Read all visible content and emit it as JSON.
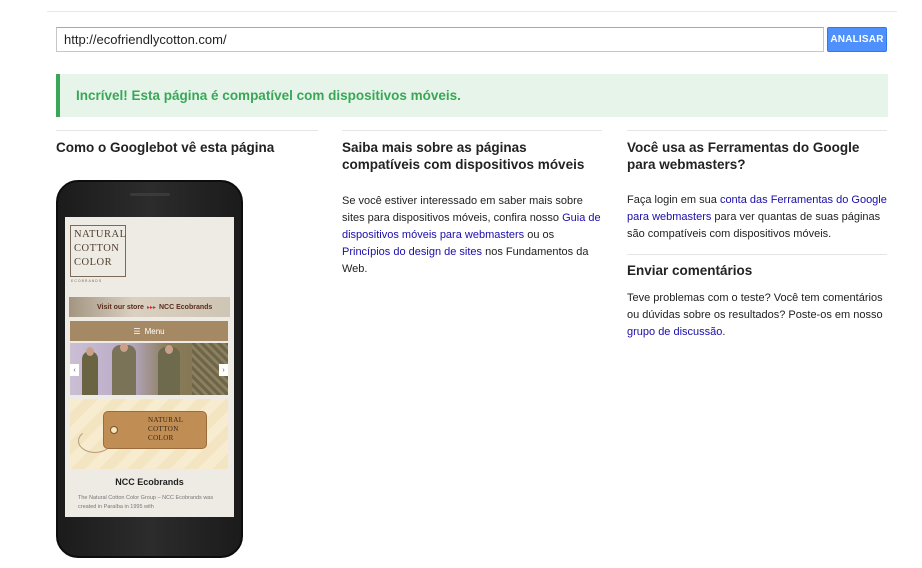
{
  "url_bar": {
    "value": "http://ecofriendlycotton.com/",
    "analyze_label": "ANALISAR"
  },
  "result": {
    "message": "Incrível! Esta página é compatível com dispositivos móveis."
  },
  "googlebot": {
    "title": "Como o Googlebot vê esta página",
    "phone": {
      "logo_lines": [
        "NATURAL",
        "COTTON",
        "COLOR"
      ],
      "logo_sub": "ECOBRANDS",
      "banner_text": "Visit our store",
      "banner_arrows": "▸▸▸",
      "banner_brand": "NCC Ecobrands",
      "menu_label": "Menu",
      "tag_lines": [
        "NATURAL",
        "COTTON",
        "COLOR"
      ],
      "section_title": "NCC Ecobrands",
      "section_body": "The Natural Cotton Color Group – NCC Ecobrands was created in Paraíba in 1995 with"
    }
  },
  "learn_more": {
    "title": "Saiba mais sobre as páginas compatíveis com dispositivos móveis",
    "text_1": "Se você estiver interessado em saber mais sobre sites para dispositivos móveis, confira nosso ",
    "link_1": "Guia de dispositivos móveis para webmasters",
    "text_2": " ou os ",
    "link_2": "Princípios do design de sites",
    "text_3": " nos Fundamentos da Web."
  },
  "webmaster_tools": {
    "title": "Você usa as Ferramentas do Google para webmasters?",
    "text_1": "Faça login em sua ",
    "link_1": "conta das Ferramentas do Google para webmasters",
    "text_2": " para ver quantas de suas páginas são compatíveis com dispositivos móveis."
  },
  "feedback": {
    "title": "Enviar comentários",
    "text_1": "Teve problemas com o teste? Você tem comentários ou dúvidas sobre os resultados? Poste-os em nosso ",
    "link_1": "grupo de discussão",
    "text_2": "."
  },
  "icons": {
    "menu": "hamburger-icon",
    "prev": "chevron-left-icon",
    "next": "chevron-right-icon"
  },
  "colors": {
    "button_blue": "#4d90fe",
    "success_green": "#3aa757",
    "success_bg": "#e6f4ea",
    "link_blue": "#1a0dab"
  }
}
